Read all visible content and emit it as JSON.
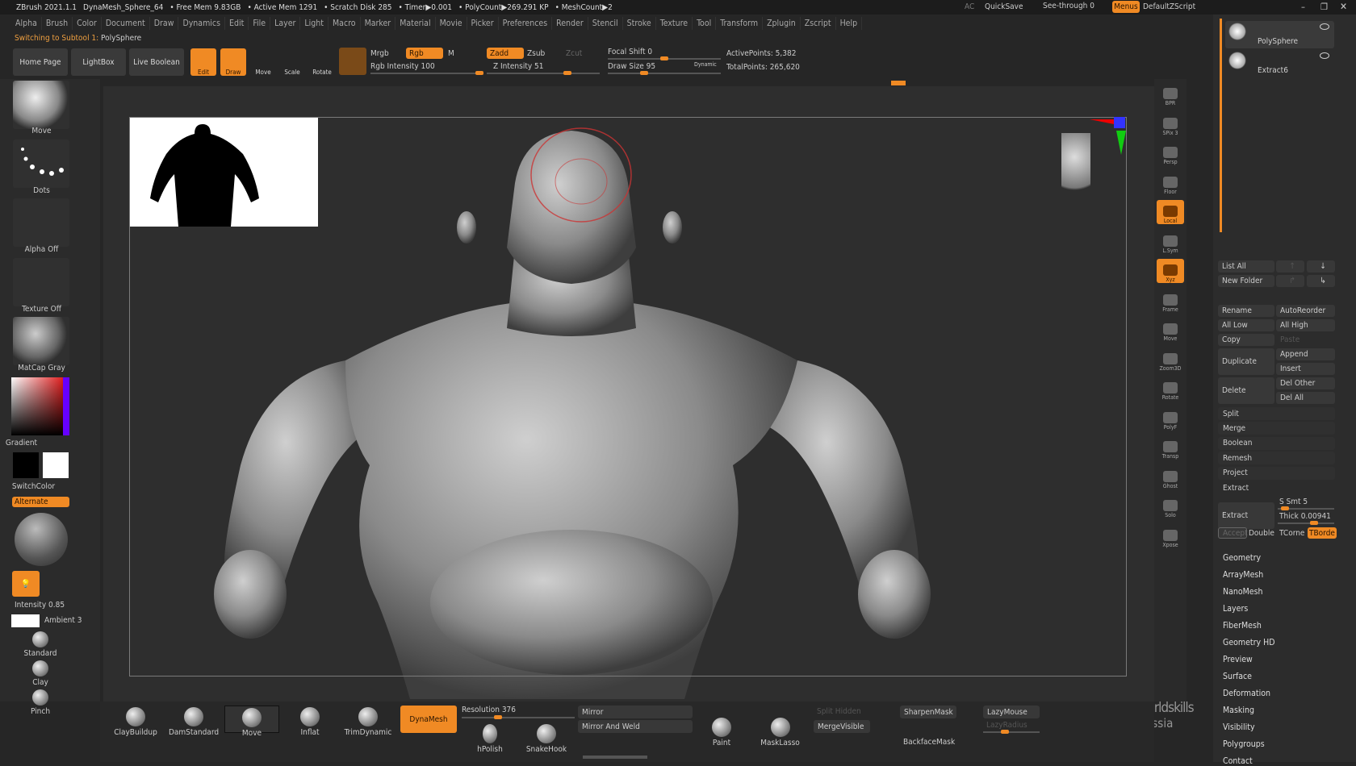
{
  "title_bar": {
    "items": [
      "ZBrush 2021.1.1",
      "DynaMesh_Sphere_64",
      "• Free Mem 9.83GB",
      "• Active Mem 1291",
      "• Scratch Disk 285",
      "• Timer▶0.001",
      "• PolyCount▶269.291 KP",
      "• MeshCount▶2"
    ],
    "right": {
      "ac": "AC",
      "quicksave": "QuickSave",
      "see_through": "See-through  0",
      "menus": "Menus",
      "script": "DefaultZScript"
    }
  },
  "menu": [
    "Alpha",
    "Brush",
    "Color",
    "Document",
    "Draw",
    "Dynamics",
    "Edit",
    "File",
    "Layer",
    "Light",
    "Macro",
    "Marker",
    "Material",
    "Movie",
    "Picker",
    "Preferences",
    "Render",
    "Stencil",
    "Stroke",
    "Texture",
    "Tool",
    "Transform",
    "Zplugin",
    "Zscript",
    "Help"
  ],
  "status": {
    "prefix": "Switching to Subtool 1:",
    "value": "PolySphere"
  },
  "toolbar": {
    "home": "Home Page",
    "lightbox": "LightBox",
    "live_boolean": "Live Boolean",
    "edit": "Edit",
    "draw": "Draw",
    "move": "Move",
    "scale": "Scale",
    "rotate": "Rotate",
    "mrgb": "Mrgb",
    "rgb": "Rgb",
    "m": "M",
    "rgb_intensity": "Rgb Intensity 100",
    "zadd": "Zadd",
    "zsub": "Zsub",
    "zcut": "Zcut",
    "z_intensity": "Z Intensity 51",
    "focal_shift": "Focal Shift 0",
    "draw_size": "Draw Size 95",
    "dynamic": "Dynamic",
    "active_points": "ActivePoints: 5,382",
    "total_points": "TotalPoints: 265,620"
  },
  "left": {
    "brush": "Move",
    "stroke": "Dots",
    "alpha": "Alpha Off",
    "texture": "Texture Off",
    "material": "MatCap Gray",
    "gradient": "Gradient",
    "switch_color": "SwitchColor",
    "alternate": "Alternate",
    "intensity": "Intensity 0.85",
    "ambient": "Ambient 3",
    "brushes": [
      "Standard",
      "Clay",
      "Pinch"
    ]
  },
  "right_shelf": [
    "BPR",
    "SPix 3",
    "Persp",
    "Floor",
    "Local",
    "L.Sym",
    "Xyz",
    "Frame",
    "Move",
    "Zoom3D",
    "Rotate",
    "PolyF",
    "Transp",
    "Ghost",
    "Solo",
    "Xpose"
  ],
  "subtools": [
    {
      "name": "PolySphere"
    },
    {
      "name": "Extract6"
    }
  ],
  "subtool_buttons": {
    "list_all": "List All",
    "new_folder": "New Folder",
    "rename": "Rename",
    "auto_reorder": "AutoReorder",
    "all_low": "All Low",
    "all_high": "All High",
    "copy": "Copy",
    "paste": "Paste",
    "duplicate": "Duplicate",
    "append": "Append",
    "insert": "Insert",
    "delete": "Delete",
    "del_other": "Del Other",
    "del_all": "Del All"
  },
  "subtool_sections": [
    "Split",
    "Merge",
    "Boolean",
    "Remesh",
    "Project",
    "Extract"
  ],
  "extract": {
    "button": "Extract",
    "s_smt": "S Smt 5",
    "thick": "Thick 0.00941",
    "accept": "Accept",
    "double": "Double",
    "tcorner": "TCorne",
    "tborder": "TBorde"
  },
  "tool_menu": [
    "Geometry",
    "ArrayMesh",
    "NanoMesh",
    "Layers",
    "FiberMesh",
    "Geometry HD",
    "Preview",
    "Surface",
    "Deformation",
    "Masking",
    "Visibility",
    "Polygroups",
    "Contact"
  ],
  "bottom": {
    "brushes": [
      "ClayBuildup",
      "DamStandard",
      "Move",
      "Inflat",
      "TrimDynamic"
    ],
    "dynamesh": "DynaMesh",
    "resolution": "Resolution 376",
    "hpolish": "hPolish",
    "snakehook": "SnakeHook",
    "mirror": "Mirror",
    "mirror_weld": "Mirror And Weld",
    "paint": "Paint",
    "masklasso": "MaskLasso",
    "split_hidden": "Split Hidden",
    "merge_visible": "MergeVisible",
    "sharpen_mask": "SharpenMask",
    "backface_mask": "BackfaceMask",
    "lazymouse": "LazyMouse",
    "lazyradius": "LazyRadius"
  },
  "watermark": {
    "text": "worldskills Russia"
  },
  "colors": {
    "accent": "#f08a24",
    "bg": "#262626"
  }
}
